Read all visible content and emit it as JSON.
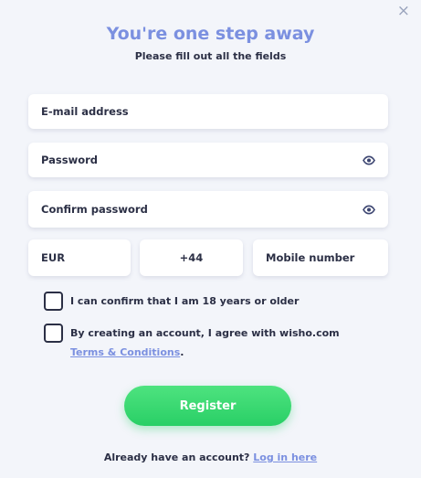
{
  "close_icon": "×",
  "header": {
    "title": "You're one step away",
    "subtitle": "Please fill out all the fields"
  },
  "form": {
    "email_placeholder": "E-mail address",
    "password_placeholder": "Password",
    "confirm_password_placeholder": "Confirm password",
    "currency": "EUR",
    "phone_code": "+44",
    "mobile_placeholder": "Mobile number"
  },
  "checks": {
    "age_label": "I can confirm that I am 18 years or older",
    "terms_prefix": "By creating an account, I agree with wisho.com ",
    "terms_link": "Terms & Conditions",
    "terms_suffix": "."
  },
  "register_label": "Register",
  "footer": {
    "prompt": "Already have an account? ",
    "login_link": "Log in here"
  },
  "colors": {
    "accent": "#7b90e0",
    "button": "#29cf66",
    "background": "#f3f5fa"
  },
  "icons": [
    "close-icon",
    "eye-icon"
  ]
}
